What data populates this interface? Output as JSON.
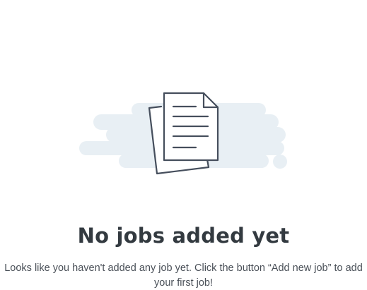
{
  "empty_state": {
    "illustration_icon": "documents-icon",
    "title": "No jobs added yet",
    "message": "Looks like you haven't added any job yet. Click the button “Add new job” to add your first job!",
    "colors": {
      "cloud": "#e8eff4",
      "stroke": "#454e5c",
      "title": "#333a40",
      "text": "#4a5058"
    }
  }
}
